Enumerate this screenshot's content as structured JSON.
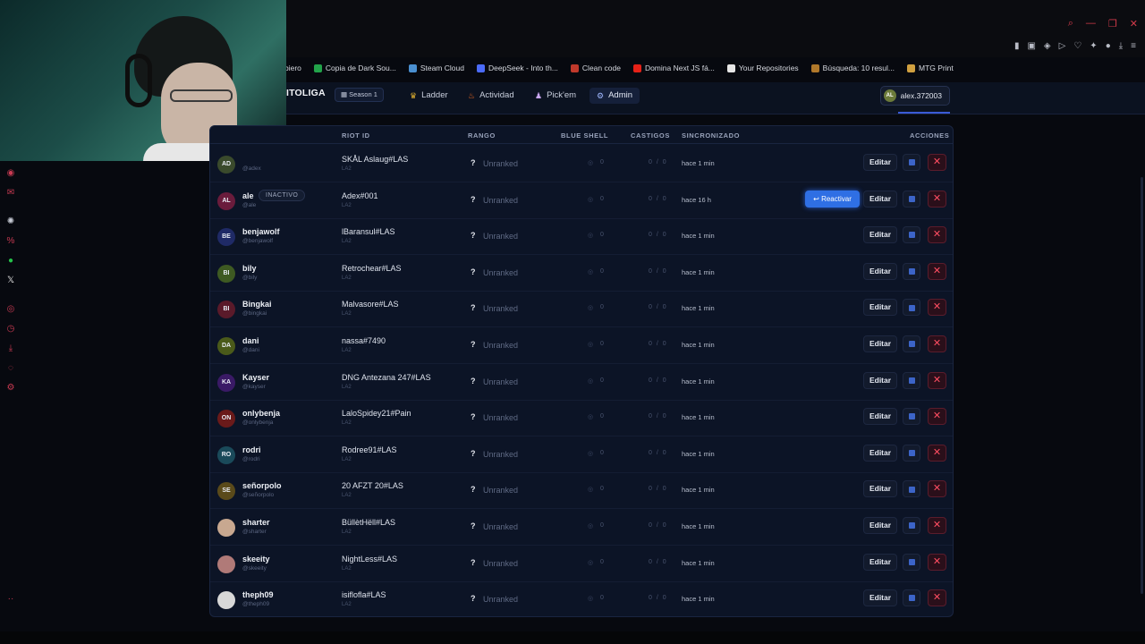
{
  "browser": {
    "bookmarks": [
      {
        "label": "biero",
        "icon": "bookmark-icon",
        "color": "#0b0c10"
      },
      {
        "label": "Copia de Dark Sou...",
        "icon": "sheets-icon",
        "color": "#22a34a"
      },
      {
        "label": "Steam Cloud",
        "icon": "steam-icon",
        "color": "#4a8fd0"
      },
      {
        "label": "DeepSeek - Into th...",
        "icon": "deepseek-icon",
        "color": "#4b6bfa"
      },
      {
        "label": "Clean code",
        "icon": "clean-code-icon",
        "color": "#c0392b"
      },
      {
        "label": "Domina Next JS fá...",
        "icon": "youtube-icon",
        "color": "#e62117"
      },
      {
        "label": "Your Repositories",
        "icon": "github-icon",
        "color": "#e6e6e6"
      },
      {
        "label": "Búsqueda: 10 resul...",
        "icon": "search-result-icon",
        "color": "#b0782a"
      },
      {
        "label": "MTG Print",
        "icon": "mtg-icon",
        "color": "#d0a040"
      }
    ]
  },
  "app": {
    "logo": "ITOLIGA",
    "season": "Season 1",
    "nav": [
      {
        "label": "Ladder",
        "icon": "trophy-icon"
      },
      {
        "label": "Actividad",
        "icon": "fire-icon"
      },
      {
        "label": "Pick'em",
        "icon": "pickem-icon"
      },
      {
        "label": "Admin",
        "icon": "gear-icon"
      }
    ],
    "user": {
      "initials": "AL",
      "name": "alex.372003"
    }
  },
  "table": {
    "headers": {
      "riot_id": "RIOT ID",
      "rango": "RANGO",
      "blue_shell": "BLUE SHELL",
      "castigos": "CASTIGOS",
      "sincronizado": "SINCRONIZADO",
      "acciones": "ACCIONES"
    },
    "rows": [
      {
        "initials": "AD",
        "color": "#3a4a2c",
        "name": "",
        "handle": "@adex",
        "riot": "SKÅL Aslaug#LAS",
        "region": "LA2",
        "rank": "Unranked",
        "blue_shell": "0",
        "castigos": "0 / 0",
        "sync": "hace 1 min"
      },
      {
        "initials": "AL",
        "color": "#6a1c3c",
        "name": "ale",
        "handle": "@ale",
        "badge": "INACTIVO",
        "riot": "Adex#001",
        "region": "LA2",
        "rank": "Unranked",
        "blue_shell": "0",
        "castigos": "0 / 0",
        "sync": "hace 16 h",
        "reactivar": "↩ Reactivar"
      },
      {
        "initials": "BE",
        "color": "#1f2a66",
        "name": "benjawolf",
        "handle": "@benjawolf",
        "riot": "lBaransul#LAS",
        "region": "LA2",
        "rank": "Unranked",
        "blue_shell": "0",
        "castigos": "0 / 0",
        "sync": "hace 1 min"
      },
      {
        "initials": "BI",
        "color": "#3e5a22",
        "name": "bily",
        "handle": "@bily",
        "riot": "Retrochear#LAS",
        "region": "LA2",
        "rank": "Unranked",
        "blue_shell": "0",
        "castigos": "0 / 0",
        "sync": "hace 1 min"
      },
      {
        "initials": "BI",
        "color": "#5a1a2a",
        "name": "Bingkai",
        "handle": "@bingkai",
        "riot": "Malvasore#LAS",
        "region": "LA2",
        "rank": "Unranked",
        "blue_shell": "0",
        "castigos": "0 / 0",
        "sync": "hace 1 min"
      },
      {
        "initials": "DA",
        "color": "#4a5a1a",
        "name": "dani",
        "handle": "@dani",
        "riot": "nassa#7490",
        "region": "LA2",
        "rank": "Unranked",
        "blue_shell": "0",
        "castigos": "0 / 0",
        "sync": "hace 1 min"
      },
      {
        "initials": "KA",
        "color": "#3a1a66",
        "name": "Kayser",
        "handle": "@kayser",
        "riot": "DNG Antezana 247#LAS",
        "region": "LA2",
        "rank": "Unranked",
        "blue_shell": "0",
        "castigos": "0 / 0",
        "sync": "hace 1 min"
      },
      {
        "initials": "ON",
        "color": "#6a1a1a",
        "name": "onlybenja",
        "handle": "@onlybenja",
        "riot": "LaloSpidey21#Pain",
        "region": "LA2",
        "rank": "Unranked",
        "blue_shell": "0",
        "castigos": "0 / 0",
        "sync": "hace 1 min"
      },
      {
        "initials": "RO",
        "color": "#1a4a5a",
        "name": "rodri",
        "handle": "@rodri",
        "riot": "Rodree91#LAS",
        "region": "LA2",
        "rank": "Unranked",
        "blue_shell": "0",
        "castigos": "0 / 0",
        "sync": "hace 1 min"
      },
      {
        "initials": "SE",
        "color": "#5a4a1a",
        "name": "señorpolo",
        "handle": "@señorpolo",
        "riot": "20 AFZT 20#LAS",
        "region": "LA2",
        "rank": "Unranked",
        "blue_shell": "0",
        "castigos": "0 / 0",
        "sync": "hace 1 min"
      },
      {
        "initials": "",
        "color": "#c8a890",
        "name": "sharter",
        "handle": "@sharter",
        "riot": "BüllètHëll#LAS",
        "region": "LA2",
        "rank": "Unranked",
        "blue_shell": "0",
        "castigos": "0 / 0",
        "sync": "hace 1 min"
      },
      {
        "initials": "",
        "color": "#b07a78",
        "name": "skeeity",
        "handle": "@skeeity",
        "riot": "NightLess#LAS",
        "region": "LA2",
        "rank": "Unranked",
        "blue_shell": "0",
        "castigos": "0 / 0",
        "sync": "hace 1 min"
      },
      {
        "initials": "",
        "color": "#d8d8d8",
        "name": "theph09",
        "handle": "@theph09",
        "riot": "isiflofla#LAS",
        "region": "LA2",
        "rank": "Unranked",
        "blue_shell": "0",
        "castigos": "0 / 0",
        "sync": "hace 1 min"
      }
    ],
    "actions": {
      "edit": "Editar",
      "delete": "✕",
      "rank_icon": "?",
      "shell_icon": "◎"
    }
  }
}
